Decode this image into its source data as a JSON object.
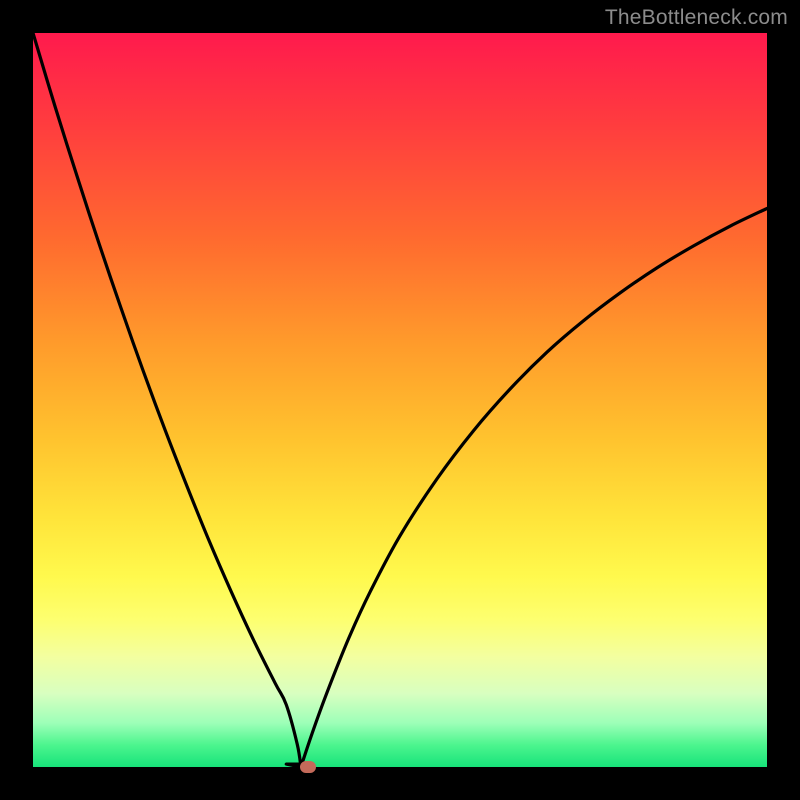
{
  "watermark": "TheBottleneck.com",
  "colors": {
    "frame": "#000000",
    "gradient_top": "#ff1a4d",
    "gradient_bottom": "#17e37a",
    "curve": "#000000",
    "dot": "#c46a5a"
  },
  "chart_data": {
    "type": "line",
    "title": "",
    "xlabel": "",
    "ylabel": "",
    "xlim": [
      0,
      100
    ],
    "ylim": [
      0,
      100
    ],
    "notch_x": 36.5,
    "dot": {
      "x": 37.5,
      "y": 0
    },
    "series": [
      {
        "name": "left-branch",
        "x": [
          0,
          3,
          6,
          9,
          12,
          15,
          18,
          21,
          24,
          27,
          30,
          33,
          34.5,
          36,
          36.5
        ],
        "values": [
          100,
          90,
          80.5,
          71.3,
          62.5,
          54,
          45.9,
          38.2,
          30.8,
          23.9,
          17.4,
          11.4,
          8.5,
          3.1,
          0
        ]
      },
      {
        "name": "right-branch",
        "x": [
          36.5,
          38,
          40,
          43,
          46,
          50,
          55,
          60,
          65,
          70,
          75,
          80,
          85,
          90,
          95,
          100
        ],
        "values": [
          0,
          4.5,
          10,
          17.5,
          24,
          31.5,
          39.2,
          45.8,
          51.5,
          56.5,
          60.8,
          64.6,
          68,
          71,
          73.7,
          76.1
        ]
      }
    ],
    "flat_segment": {
      "x0": 34.5,
      "x1": 38.0,
      "y": 0.4
    }
  }
}
